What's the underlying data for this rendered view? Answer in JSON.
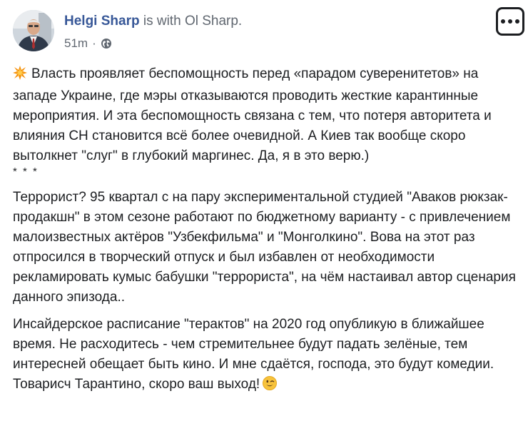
{
  "post": {
    "author": "Helgi Sharp",
    "with_text": "is with",
    "tagged": "Ol Sharp.",
    "time": "51m",
    "separator": "·",
    "privacy_icon": "globe-icon",
    "more_icon": "more-options-icon",
    "emoji_start": "collision-emoji",
    "emoji_end": "winking-face-emoji",
    "paragraphs": [
      "Власть проявляет беспомощность перед «парадом суверенитетов» на западе Украине, где мэры отказываются проводить жесткие карантинные мероприятия. И эта беспомощность связана с тем, что потеря авторитета и влияния СН становится всё более очевидной. А Киев так вообще скоро вытолкнет \"слуг\" в глубокий маргинес. Да, я в это верю.)",
      "Террорист? 95 квартал с на пару экспериментальной студией \"Аваков рюкзак-продакшн\" в этом сезоне работают по бюджетному варианту - с привлечением малоизвестных актёров \"Узбекфильма\" и \"Монголкино\". Вова на этот раз отпросился в творческий отпуск и был избавлен от необходимости рекламировать кумыс бабушки \"террориста\", на чём настаивал автор сценария данного эпизода..",
      "Инсайдерское расписание \"терактов\" на 2020 год опубликую в ближайшее время. Не расходитесь - чем стремительнее будут падать зелёные, тем интересней обещает быть кино. И мне сдаётся, господа, это будут комедии. Товарисч Тарантино, скоро ваш выход!"
    ],
    "stars": "* * *"
  },
  "colors": {
    "author_link": "#385898",
    "meta_gray": "#606770",
    "text": "#1c1e21"
  }
}
